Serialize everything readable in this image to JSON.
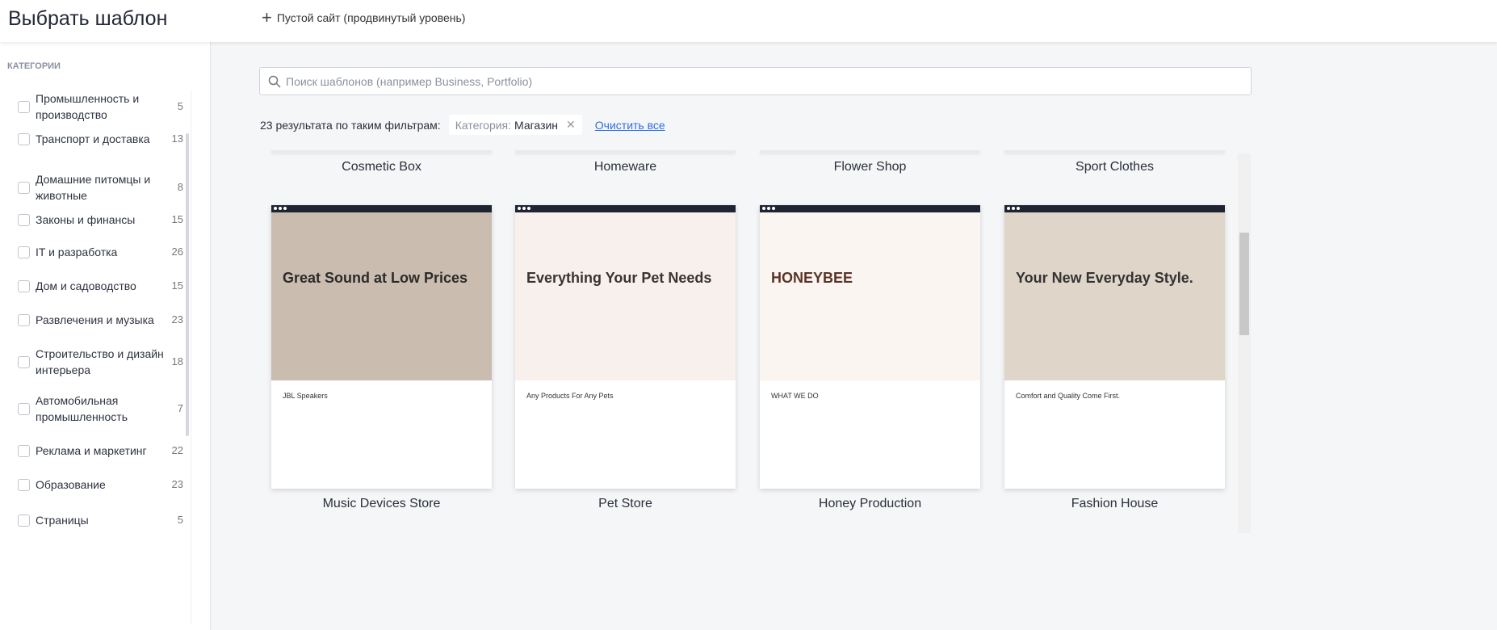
{
  "header": {
    "title": "Выбрать шаблон",
    "blank_site": "Пустой сайт (продвинутый уровень)"
  },
  "sidebar": {
    "heading": "КАТЕГОРИИ",
    "items": [
      {
        "label": "Промышленность и производство",
        "count": "5"
      },
      {
        "label": "Транспорт и доставка",
        "count": "13"
      },
      {
        "label": "Домашние питомцы и животные",
        "count": "8"
      },
      {
        "label": "Законы и финансы",
        "count": "15"
      },
      {
        "label": "IT и разработка",
        "count": "26"
      },
      {
        "label": "Дом и садоводство",
        "count": "15"
      },
      {
        "label": "Развлечения и музыка",
        "count": "23"
      },
      {
        "label": "Строительство и дизайн интерьера",
        "count": "18"
      },
      {
        "label": "Автомобильная промышленность",
        "count": "7"
      },
      {
        "label": "Реклама и маркетинг",
        "count": "22"
      },
      {
        "label": "Образование",
        "count": "23"
      },
      {
        "label": "Страницы",
        "count": "5"
      }
    ]
  },
  "search": {
    "placeholder": "Поиск шаблонов (например Business, Portfolio)"
  },
  "filters": {
    "results": "23 результата по таким фильтрам:",
    "chip_key": "Категория:",
    "chip_value": "Магазин",
    "clear": "Очистить все"
  },
  "top_row": [
    "Cosmetic Box",
    "Homeware",
    "Flower Shop",
    "Sport Clothes"
  ],
  "cards": [
    {
      "name": "Music Devices Store",
      "headline": "Great Sound at Low Prices",
      "sub": "JBL Speakers",
      "bg": "#cbbcb0",
      "color": "#2b2b2b"
    },
    {
      "name": "Pet Store",
      "headline": "Everything Your Pet Needs",
      "sub": "Any Products For Any Pets",
      "bg": "#f8f0ec",
      "color": "#3a3330"
    },
    {
      "name": "Honey Production",
      "headline": "HONEYBEE",
      "sub": "WHAT WE DO",
      "bg": "#fbf5f1",
      "color": "#5a3328"
    },
    {
      "name": "Fashion House",
      "headline": "Your New Everyday Style.",
      "sub": "Comfort and Quality Come First.",
      "bg": "#e0d5c9",
      "color": "#333"
    }
  ]
}
